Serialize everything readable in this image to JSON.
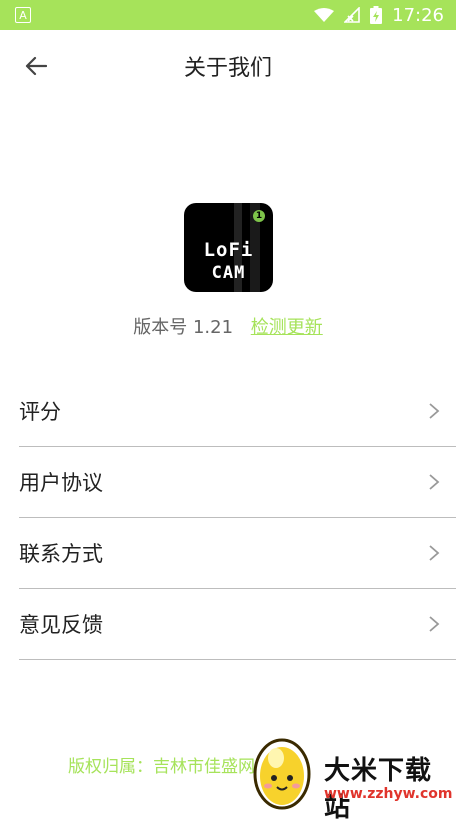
{
  "status_bar": {
    "left_badge": "A",
    "time": "17:26",
    "icons": [
      "wifi-icon",
      "no-signal-icon",
      "battery-charging-icon"
    ],
    "background_color": "#a6e35a"
  },
  "header": {
    "title": "关于我们",
    "back_icon": "arrow-left-icon"
  },
  "app": {
    "icon_text_line1": "LoFi",
    "icon_text_line2": "CAM",
    "icon_badge": "1",
    "version_label": "版本号 1.21",
    "update_link": "检测更新",
    "accent_color": "#a6e35a"
  },
  "menu": {
    "items": [
      {
        "label": "评分",
        "icon": "chevron-right-icon"
      },
      {
        "label": "用户协议",
        "icon": "chevron-right-icon"
      },
      {
        "label": "联系方式",
        "icon": "chevron-right-icon"
      },
      {
        "label": "意见反馈",
        "icon": "chevron-right-icon"
      }
    ]
  },
  "footer": {
    "copyright": "版权归属：吉林市佳盛网"
  },
  "watermark": {
    "title": "大米下载站",
    "url": "www.zzhyw.com"
  }
}
